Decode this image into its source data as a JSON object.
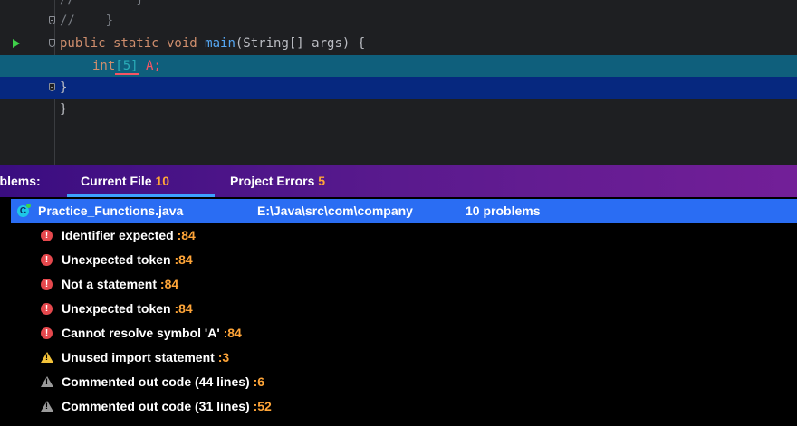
{
  "editor": {
    "lines": [
      {
        "text": "//        }"
      },
      {
        "text": "//    }"
      },
      {
        "kw": "public static void ",
        "fn": "main",
        "rest": "(String[] args) {"
      },
      {
        "kw": "int",
        "open": "[",
        "num": "5",
        "close": "]",
        "var": " A;"
      },
      {
        "text": "}"
      },
      {
        "text": "}"
      }
    ]
  },
  "problems": {
    "title": "oblems:",
    "tabs": [
      {
        "label": "Current File",
        "count": "10"
      },
      {
        "label": "Project Errors",
        "count": "5"
      }
    ],
    "file": {
      "icon_letter": "C",
      "name": "Practice_Functions.java",
      "path": "E:\\Java\\src\\com\\company",
      "count": "10 problems"
    },
    "items": [
      {
        "severity": "error",
        "icon": "error-icon",
        "message": "Identifier expected",
        "line": ":84"
      },
      {
        "severity": "error",
        "icon": "error-icon",
        "message": "Unexpected token",
        "line": ":84"
      },
      {
        "severity": "error",
        "icon": "error-icon",
        "message": "Not a statement",
        "line": ":84"
      },
      {
        "severity": "error",
        "icon": "error-icon",
        "message": "Unexpected token",
        "line": ":84"
      },
      {
        "severity": "error",
        "icon": "error-icon",
        "message": "Cannot resolve symbol 'A'",
        "line": ":84"
      },
      {
        "severity": "warning",
        "icon": "warning-icon",
        "message": "Unused import statement",
        "line": ":3"
      },
      {
        "severity": "weak-warning",
        "icon": "weak-warning-icon",
        "message": "Commented out code (44 lines)",
        "line": ":6"
      },
      {
        "severity": "weak-warning",
        "icon": "weak-warning-icon",
        "message": "Commented out code (31 lines)",
        "line": ":52"
      }
    ]
  },
  "colors": {
    "error": "#e5484d",
    "warning": "#f2c23a",
    "weak_warning": "#9a9a9a",
    "line_number": "#ffa538",
    "selected_row": "#2a6df3",
    "tab_underline": "#3ea1ff"
  }
}
